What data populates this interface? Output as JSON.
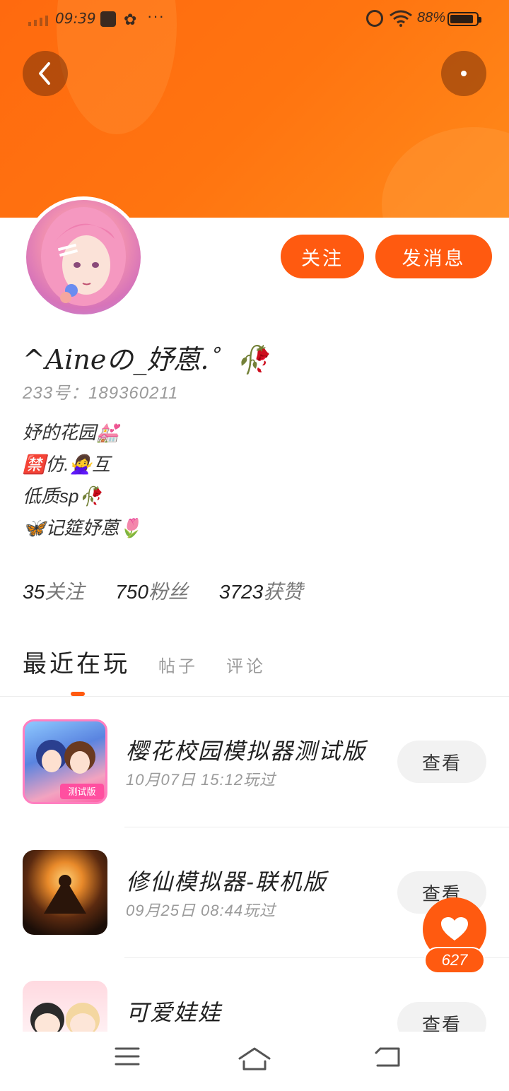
{
  "status_bar": {
    "time": "09:39",
    "battery_pct": "88%",
    "battery_level": 0.88,
    "overflow": "···"
  },
  "header": {
    "accent_color": "#ff6a0f",
    "back_icon": "chevron-left-icon",
    "more_icon": "more-horizontal-icon"
  },
  "profile": {
    "name": "^Aineの_妤蒽.゜🥀",
    "uid": "233号：189360211",
    "bio": [
      "妤的花园💒",
      "🈲仿.🙅‍♀️互",
      "低质sp🥀",
      "🦋记筵妤蒽🌷"
    ],
    "follow_label": "关注",
    "message_label": "发消息"
  },
  "stats": [
    {
      "num": "35",
      "label": "关注"
    },
    {
      "num": "750",
      "label": "粉丝"
    },
    {
      "num": "3723",
      "label": "获赞"
    }
  ],
  "tabs": [
    "最近在玩",
    "帖子",
    "评论"
  ],
  "games": [
    {
      "title": "樱花校园模拟器测试版",
      "time": "10月07日 15:12玩过",
      "button": "查看",
      "badge": "测试版"
    },
    {
      "title": "修仙模拟器-联机版",
      "time": "09月25日 08:44玩过",
      "button": "查看"
    },
    {
      "title": "可爱娃娃",
      "time": "",
      "button": "查看"
    }
  ],
  "like": {
    "count": "627",
    "icon": "heart-icon"
  },
  "nav": {
    "menu_icon": "menu-icon",
    "home_icon": "home-icon",
    "back_icon": "back-icon"
  }
}
